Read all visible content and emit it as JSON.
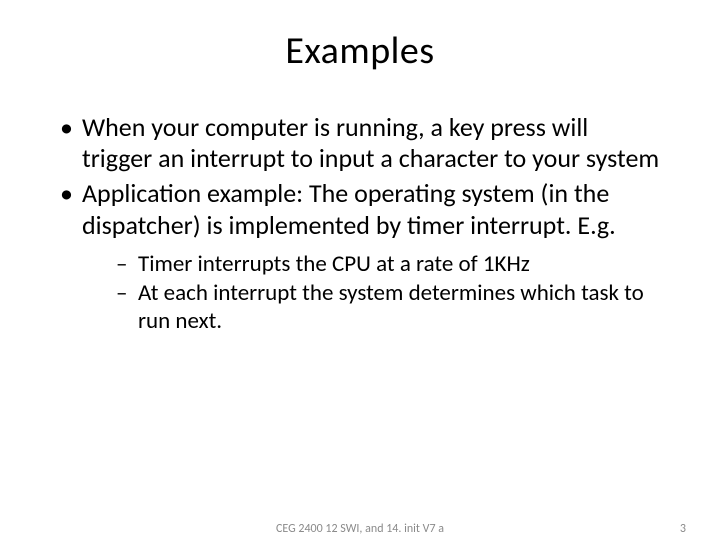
{
  "title": "Examples",
  "bullets": [
    {
      "text": "When your computer is running, a key press will trigger an interrupt to input a character to your system",
      "children": []
    },
    {
      "text": "Application example: The operating system (in the dispatcher) is implemented by timer interrupt. E.g.",
      "children": [
        "Timer interrupts the CPU at a rate of 1KHz",
        "At each interrupt the system determines which task to run next."
      ]
    }
  ],
  "footer": {
    "center": "CEG 2400 12 SWI, and 14. init V7 a",
    "page": "3"
  }
}
